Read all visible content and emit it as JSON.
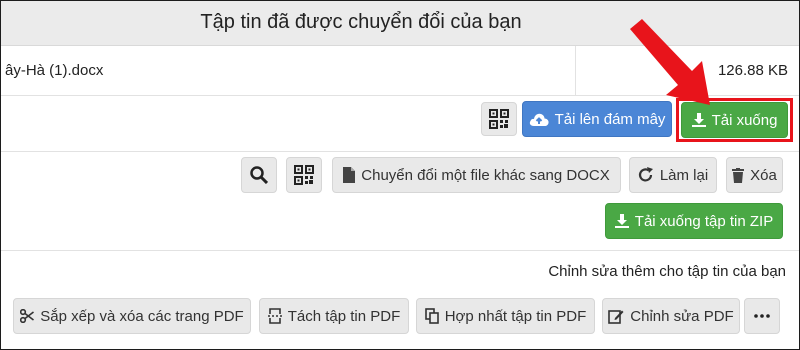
{
  "header": {
    "title": "Tập tin đã được chuyển đổi của bạn"
  },
  "file": {
    "name": "ây-Hà (1).docx",
    "size": "126.88 KB"
  },
  "actions": {
    "upload_cloud": "Tải lên đám mây",
    "download": "Tải xuống"
  },
  "toolbar": {
    "convert_other": "Chuyển đổi một file khác sang DOCX",
    "redo": "Làm lại",
    "delete": "Xóa"
  },
  "download_zip": "Tải xuống tập tin ZIP",
  "edit_more": {
    "label": "Chỉnh sửa thêm cho tập tin của bạn",
    "buttons": [
      "Sắp xếp và xóa các trang PDF",
      "Tách tập tin PDF",
      "Hợp nhất tập tin PDF",
      "Chỉnh sửa PDF"
    ]
  },
  "colors": {
    "download_green": "#4aa845",
    "cloud_blue": "#4b86d6",
    "highlight_red": "#e8141b"
  },
  "icons": [
    "qr-code-icon",
    "cloud-upload-icon",
    "download-icon",
    "search-icon",
    "file-icon",
    "redo-icon",
    "trash-icon",
    "scissors-icon",
    "split-icon",
    "merge-icon",
    "edit-icon",
    "more-icon",
    "arrow-pointer-icon"
  ]
}
